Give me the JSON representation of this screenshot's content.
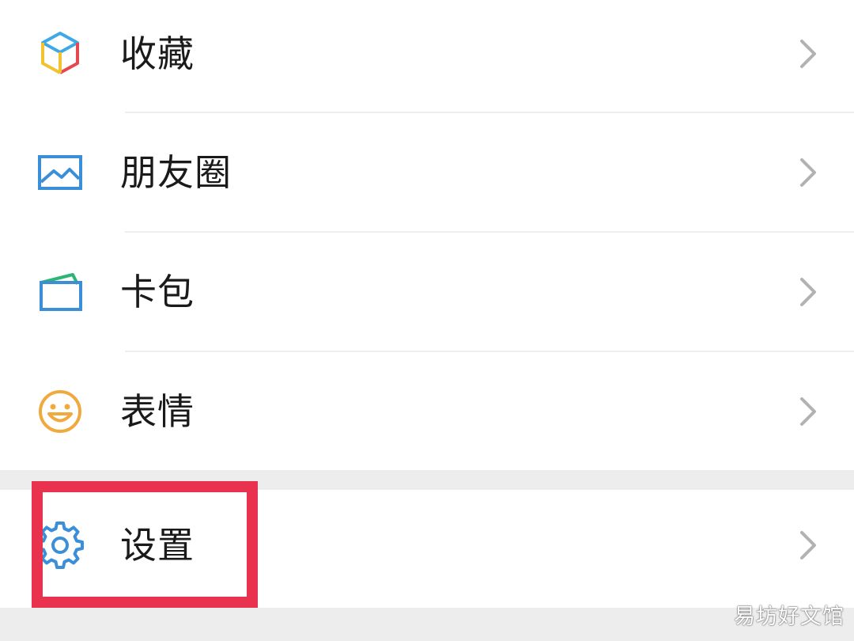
{
  "menu": {
    "items": [
      {
        "label": "收藏",
        "icon": "favorites-cube-icon"
      },
      {
        "label": "朋友圈",
        "icon": "moments-picture-icon"
      },
      {
        "label": "卡包",
        "icon": "card-wallet-icon"
      },
      {
        "label": "表情",
        "icon": "smiley-face-icon"
      }
    ],
    "settings": {
      "label": "设置",
      "icon": "gear-icon"
    }
  },
  "highlight_color": "#e8324e",
  "watermark": "易坊好文馆"
}
